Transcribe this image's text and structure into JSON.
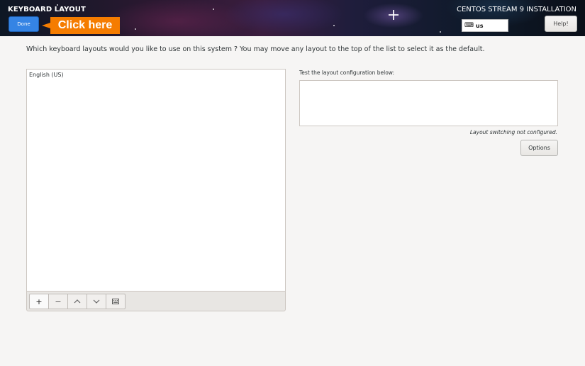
{
  "header": {
    "title": "KEYBOARD LAYOUT",
    "done_label": "Done",
    "callout_label": "Click here",
    "product": "CENTOS STREAM 9 INSTALLATION",
    "keyboard_indicator": "us",
    "keyboard_icon": "keyboard-icon",
    "help_label": "Help!"
  },
  "main": {
    "question": "Which keyboard layouts would you like to use on this system ?  You may move any layout to the top of the list to select it as the default.",
    "layouts": [
      "English (US)"
    ],
    "toolbar": {
      "add": "+",
      "remove": "−",
      "up": "⌃",
      "down": "⌄",
      "preview_icon": "keyboard-icon"
    },
    "test_label": "Test the layout configuration below:",
    "switching_note": "Layout switching not configured.",
    "options_label": "Options"
  },
  "colors": {
    "accent": "#3584e4",
    "callout": "#f57c00",
    "background": "#f6f5f4"
  }
}
